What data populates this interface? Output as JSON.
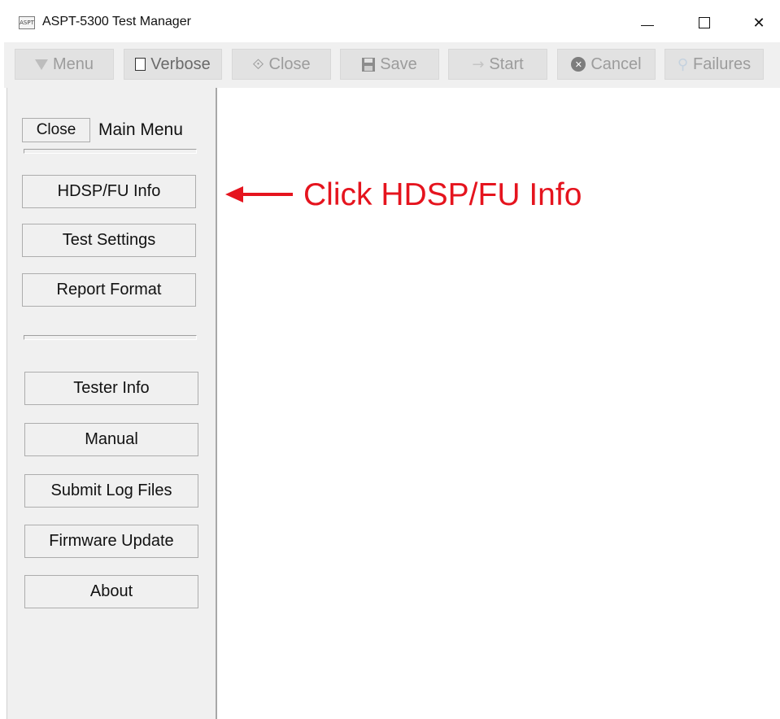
{
  "window": {
    "title": "ASPT-5300 Test Manager",
    "icon_text": "ASPT"
  },
  "title_controls": {
    "minimize_icon": "minimize-icon",
    "maximize_icon": "maximize-icon",
    "close_glyph": "✕"
  },
  "toolbar": {
    "menu_label": "Menu",
    "verbose_label": "Verbose",
    "close_label": "Close",
    "close_glyph": "⟐",
    "save_label": "Save",
    "start_label": "Start",
    "start_glyph": "→",
    "cancel_label": "Cancel",
    "cancel_glyph": "✕",
    "failures_label": "Failures",
    "failures_glyph": "⚲"
  },
  "sidebar": {
    "close_label": "Close",
    "title": "Main Menu",
    "group1": [
      {
        "label": "HDSP/FU Info"
      },
      {
        "label": "Test Settings"
      },
      {
        "label": "Report Format"
      }
    ],
    "group2": [
      {
        "label": "Tester Info"
      },
      {
        "label": "Manual"
      },
      {
        "label": "Submit Log Files"
      },
      {
        "label": "Firmware Update"
      },
      {
        "label": "About"
      }
    ]
  },
  "annotation": {
    "text": "Click HDSP/FU Info",
    "color": "#e5141e"
  },
  "colors": {
    "disabled_text": "#9c9c9c",
    "toolbar_bg": "#f0f0f0",
    "sidebar_bg": "#f0f0f0"
  }
}
